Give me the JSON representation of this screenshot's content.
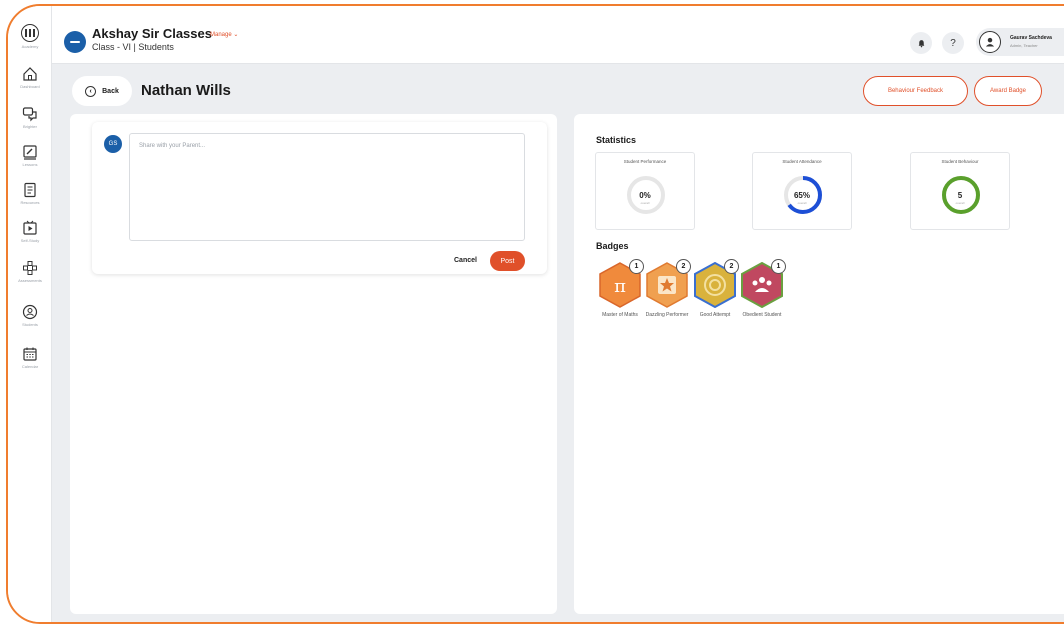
{
  "colors": {
    "accent": "#e0502a",
    "brand_blue": "#1b5fa8",
    "frame_orange": "#f07d2e",
    "attendance_ring": "#1d4fd6",
    "behaviour_ring": "#5aa02c"
  },
  "sidebar": {
    "logo_label": "Academy",
    "items": [
      {
        "icon": "home-icon",
        "label": "Dashboard"
      },
      {
        "icon": "chat-icon",
        "label": "Brighter"
      },
      {
        "icon": "lessons-icon",
        "label": "Lessons"
      },
      {
        "icon": "resources-icon",
        "label": "Resources"
      },
      {
        "icon": "self-study-icon",
        "label": "Self-Study"
      },
      {
        "icon": "assessments-icon",
        "label": "Assessments"
      },
      {
        "icon": "students-icon",
        "label": "Students"
      },
      {
        "icon": "calendar-icon",
        "label": "Calendar"
      }
    ]
  },
  "header": {
    "brand_name": "Akshay Sir Classes",
    "manage_label": "Manage",
    "breadcrumb": "Class - VI | Students",
    "notification_icon": "bell-icon",
    "help_label": "?",
    "user_name": "Gaurav Sachdeva",
    "user_role": "Admin, Teacher"
  },
  "page": {
    "back_label": "Back",
    "student_name": "Nathan Wills",
    "behaviour_feedback_label": "Behaviour Feedback",
    "award_badge_label": "Award Badge"
  },
  "composer": {
    "avatar_initials": "GS",
    "placeholder": "Share with your Parent...",
    "cancel_label": "Cancel",
    "post_label": "Post"
  },
  "statistics": {
    "title": "Statistics",
    "cards": [
      {
        "title": "Student Performance",
        "value": "0%",
        "sub": "overall",
        "fraction": 0.0
      },
      {
        "title": "Student Attendance",
        "value": "65%",
        "sub": "overall",
        "fraction": 0.65
      },
      {
        "title": "Student Behaviour",
        "value": "5",
        "sub": "overall",
        "fraction": 1.0
      }
    ]
  },
  "badges": {
    "title": "Badges",
    "items": [
      {
        "name": "Master of Maths",
        "count": "1",
        "icon": "pi-icon",
        "color": "#f08a3c"
      },
      {
        "name": "Dazzling Performer",
        "count": "2",
        "icon": "star-icon",
        "color": "#f0a050"
      },
      {
        "name": "Good Attempt",
        "count": "2",
        "icon": "target-icon",
        "color": "#d9b23c"
      },
      {
        "name": "Obedient Student",
        "count": "1",
        "icon": "group-icon",
        "color": "#c04860"
      }
    ]
  }
}
